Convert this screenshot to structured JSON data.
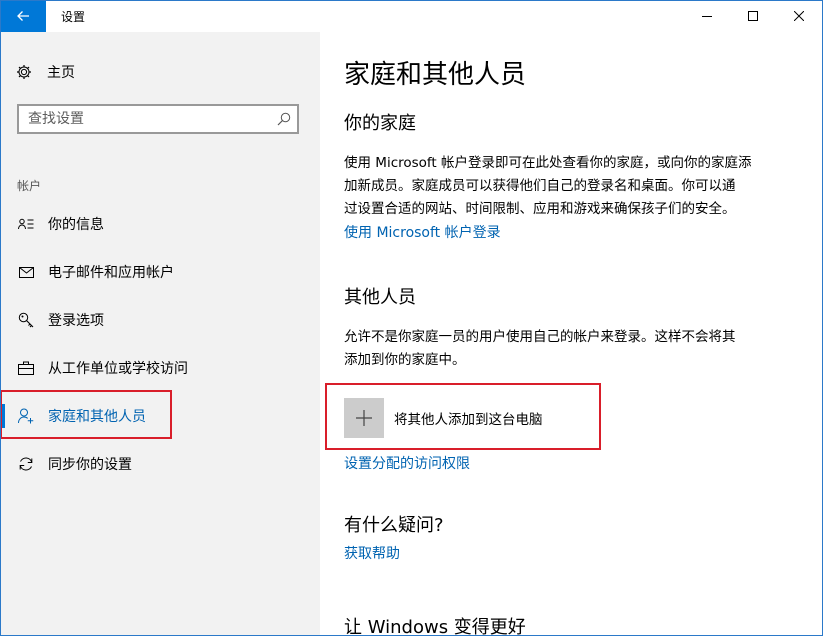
{
  "window": {
    "title": "设置",
    "back_icon": "arrow-left-icon",
    "accent": "#0078d7"
  },
  "sidebar": {
    "home_label": "主页",
    "search_placeholder": "查找设置",
    "section_label": "帐户",
    "items": [
      {
        "label": "你的信息",
        "icon": "contact-info-icon"
      },
      {
        "label": "电子邮件和应用帐户",
        "icon": "mail-icon"
      },
      {
        "label": "登录选项",
        "icon": "key-icon"
      },
      {
        "label": "从工作单位或学校访问",
        "icon": "briefcase-icon"
      },
      {
        "label": "家庭和其他人员",
        "icon": "add-person-icon",
        "selected": true
      },
      {
        "label": "同步你的设置",
        "icon": "sync-icon"
      }
    ]
  },
  "main": {
    "title": "家庭和其他人员",
    "family": {
      "heading": "你的家庭",
      "lines": [
        "使用 Microsoft 帐户登录即可在此处查看你的家庭，或向你的家庭添",
        "加新成员。家庭成员可以获得他们自己的登录名和桌面。你可以通",
        "过设置合适的网站、时间限制、应用和游戏来确保孩子们的安全。"
      ],
      "link": "使用 Microsoft 帐户登录"
    },
    "others": {
      "heading": "其他人员",
      "lines": [
        "允许不是你家庭一员的用户使用自己的帐户来登录。这样不会将其",
        "添加到你的家庭中。"
      ],
      "add_label": "将其他人添加到这台电脑",
      "link": "设置分配的访问权限"
    },
    "help": {
      "heading": "有什么疑问?",
      "link": "获取帮助"
    },
    "improve": {
      "heading": "让 Windows 变得更好"
    }
  },
  "highlight_color": "#d91e2a"
}
